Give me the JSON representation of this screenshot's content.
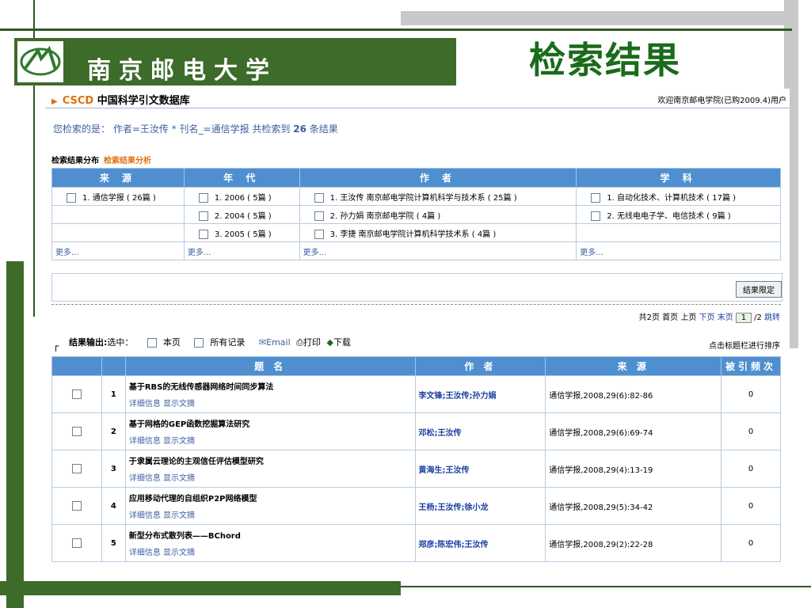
{
  "header": {
    "university": "南京邮电大学",
    "slide_title": "检索结果"
  },
  "database": {
    "cscd": "CSCD",
    "title": "中国科学引文数据库",
    "welcome": "欢迎南京邮电学院(已购2009.4)用户"
  },
  "query": {
    "prefix": "您检索的是：",
    "condition": "作者=王汝传 * 刊名_=通信学报",
    "found_prefix": "共检索到",
    "count": "26",
    "found_suffix": "条结果"
  },
  "distribution": {
    "label": "检索结果分布",
    "analysis_link": "检索结果分析"
  },
  "facets": {
    "headers": [
      "来 源",
      "年 代",
      "作 者",
      "学 科"
    ],
    "source": [
      "1. 通信学报 ( 26篇 )"
    ],
    "year": [
      "1. 2006 ( 5篇 )",
      "2. 2004 ( 5篇 )",
      "3. 2005 ( 5篇 )"
    ],
    "author": [
      "1. 王汝传 南京邮电学院计算机科学与技术系 ( 25篇 )",
      "2. 孙力娟 南京邮电学院 ( 4篇 )",
      "3. 李捷 南京邮电学院计算机科学技术系 ( 4篇 )"
    ],
    "subject": [
      "1. 自动化技术、计算机技术 ( 17篇 )",
      "2. 无线电电子学、电信技术 ( 9篇 )"
    ],
    "more": "更多...",
    "limit_button": "结果限定"
  },
  "pager": {
    "total_pages": "共2页",
    "first": "首页",
    "prev": "上页",
    "next": "下页",
    "last": "末页",
    "current": "1",
    "of": "/2",
    "jump": "跳转"
  },
  "output": {
    "label": "结果输出:",
    "select": "选中：",
    "this_page": "本页",
    "all_records": "所有记录",
    "email": "Email",
    "print": "打印",
    "download": "下载",
    "sort_note": "点击标题栏进行排序"
  },
  "results": {
    "headers": [
      "题 名",
      "作 者",
      "来 源",
      "被引频次"
    ],
    "detail_link": "详细信息",
    "abstract_link": "显示文摘",
    "rows": [
      {
        "num": "1",
        "title": "基于RBS的无线传感器网络时间同步算法",
        "authors": "李文锋;王汝传;孙力娟",
        "source": "通信学报,2008,29(6):82-86",
        "cited": "0"
      },
      {
        "num": "2",
        "title": "基于网格的GEP函数挖掘算法研究",
        "authors": "邓松;王汝传",
        "source": "通信学报,2008,29(6):69-74",
        "cited": "0"
      },
      {
        "num": "3",
        "title": "于隶属云理论的主观信任评估模型研究",
        "authors": "黄海生;王汝传",
        "source": "通信学报,2008,29(4):13-19",
        "cited": "0"
      },
      {
        "num": "4",
        "title": "应用移动代理的自组织P2P网络模型",
        "authors": "王杨;王汝传;徐小龙",
        "source": "通信学报,2008,29(5):34-42",
        "cited": "0"
      },
      {
        "num": "5",
        "title": "新型分布式散列表——BChord",
        "authors": "郑彦;陈宏伟;王汝传",
        "source": "通信学报,2008,29(2):22-28",
        "cited": "0"
      }
    ]
  }
}
